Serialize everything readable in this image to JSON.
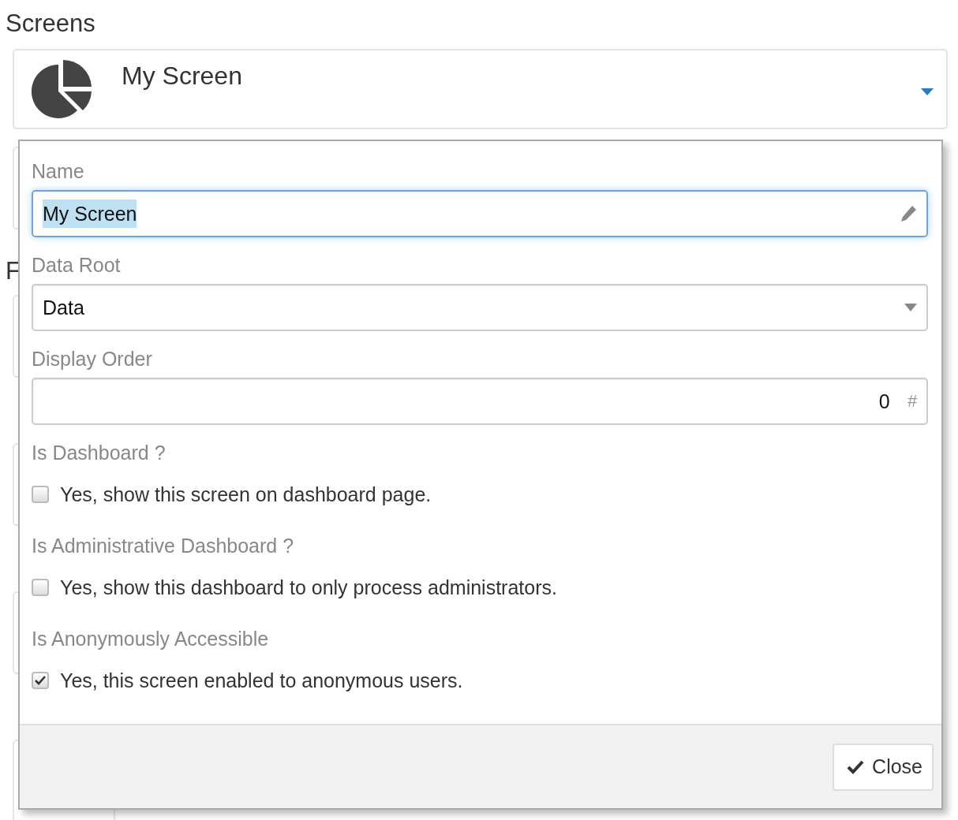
{
  "page": {
    "title": "Screens"
  },
  "screen_card": {
    "title": "My Screen"
  },
  "sections": [
    {
      "heading": "F"
    }
  ],
  "dialog": {
    "fields": [
      {
        "kind": "text",
        "label": "Name",
        "value": "My Screen",
        "focused": true,
        "text_selected": true
      },
      {
        "kind": "select",
        "label": "Data Root",
        "value": "Data",
        "focused": false,
        "text_selected": false
      },
      {
        "kind": "number",
        "label": "Display Order",
        "value": "0",
        "suffix": "#",
        "focused": false,
        "text_selected": false
      }
    ],
    "options": [
      {
        "label": "Is Dashboard ?",
        "text": "Yes, show this screen on dashboard page.",
        "checked": false
      },
      {
        "label": "Is Administrative Dashboard ?",
        "text": "Yes, show this dashboard to only process administrators.",
        "checked": false
      },
      {
        "label": "Is Anonymously Accessible",
        "text": "Yes, this screen enabled to anonymous users.",
        "checked": true
      }
    ],
    "close_button": "Close"
  }
}
